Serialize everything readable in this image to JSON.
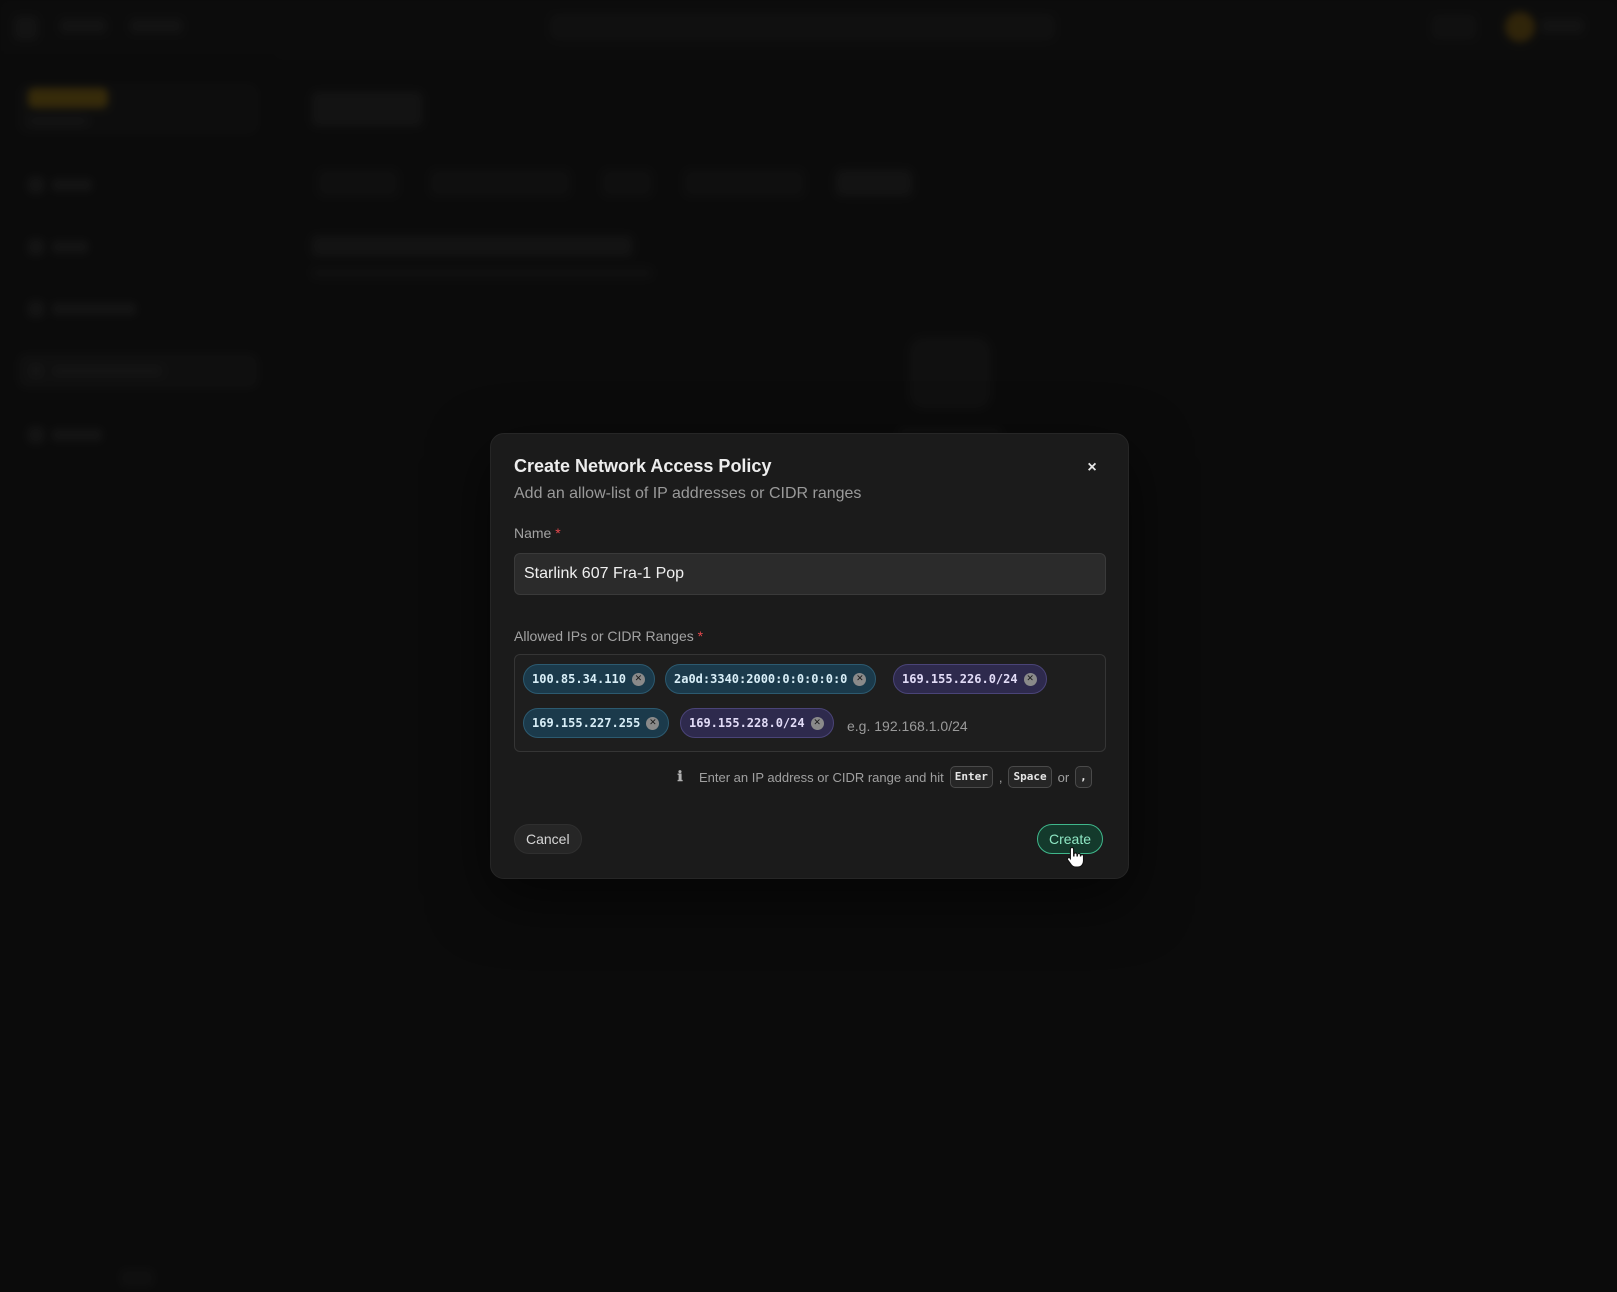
{
  "modal": {
    "title": "Create Network Access Policy",
    "subtitle": "Add an allow-list of IP addresses or CIDR ranges",
    "close_label": "×",
    "name_field": {
      "label": "Name",
      "required_mark": "*",
      "value": "Starlink 607 Fra-1 Pop"
    },
    "ranges_field": {
      "label": "Allowed IPs or CIDR Ranges",
      "required_mark": "*",
      "placeholder": "e.g. 192.168.1.0/24",
      "tags": [
        {
          "value": "100.85.34.110",
          "style": "teal"
        },
        {
          "value": "2a0d:3340:2000:0:0:0:0:0",
          "style": "teal"
        },
        {
          "value": "169.155.226.0/24",
          "style": "purple"
        },
        {
          "value": "169.155.227.255",
          "style": "teal"
        },
        {
          "value": "169.155.228.0/24",
          "style": "purple"
        }
      ]
    },
    "hint": {
      "text": "Enter an IP address or CIDR range and hit",
      "keys": [
        "Enter",
        "Space",
        ","
      ],
      "separator_1": ",",
      "separator_2": "or"
    },
    "cancel_label": "Cancel",
    "create_label": "Create"
  },
  "colors": {
    "accent": "#3fb78b",
    "tag_teal": "#1b3a4b",
    "tag_purple": "#2e2a4d",
    "required": "#e5484d"
  },
  "icons": {
    "close": "close-icon",
    "tag_remove": "remove-tag-icon",
    "hint": "info-icon",
    "pointer": "hand-pointer-cursor-icon"
  }
}
